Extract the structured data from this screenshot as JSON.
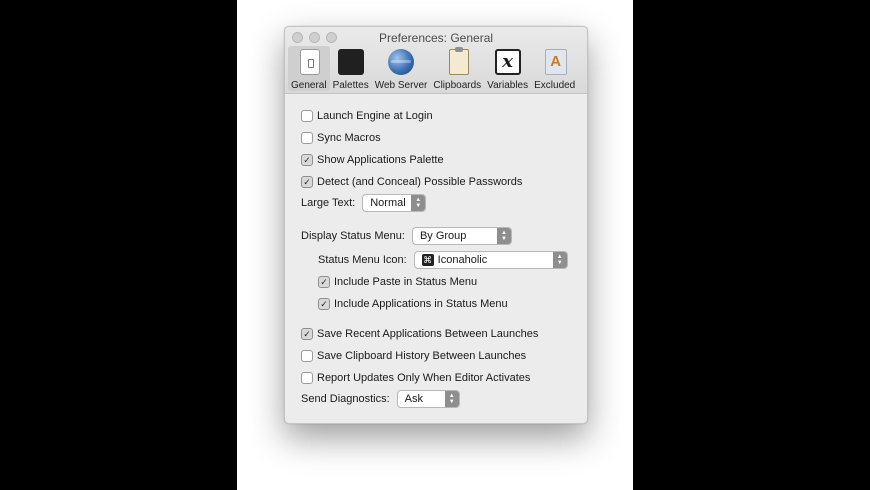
{
  "window": {
    "title": "Preferences: General"
  },
  "tabs": [
    {
      "label": "General",
      "icon": "general-icon",
      "active": true
    },
    {
      "label": "Palettes",
      "icon": "palettes-icon"
    },
    {
      "label": "Web Server",
      "icon": "globe-icon"
    },
    {
      "label": "Clipboards",
      "icon": "clipboard-icon"
    },
    {
      "label": "Variables",
      "icon": "variable-x-icon",
      "glyph": "x"
    },
    {
      "label": "Excluded",
      "icon": "excluded-app-icon",
      "glyph": "A"
    }
  ],
  "options": {
    "launch_engine": {
      "label": "Launch Engine at Login",
      "checked": false
    },
    "sync_macros": {
      "label": "Sync Macros",
      "checked": false
    },
    "show_palette": {
      "label": "Show Applications Palette",
      "checked": true
    },
    "detect_passwords": {
      "label": "Detect (and Conceal) Possible Passwords",
      "checked": true
    },
    "large_text": {
      "label": "Large Text:",
      "value": "Normal"
    },
    "display_status_menu": {
      "label": "Display Status Menu:",
      "value": "By Group"
    },
    "status_menu_icon": {
      "label": "Status Menu Icon:",
      "value": "Iconaholic",
      "glyph": "⌘"
    },
    "include_paste": {
      "label": "Include Paste in Status Menu",
      "checked": true
    },
    "include_apps": {
      "label": "Include Applications in Status Menu",
      "checked": true
    },
    "save_recent_apps": {
      "label": "Save Recent Applications Between Launches",
      "checked": true
    },
    "save_clipboard": {
      "label": "Save Clipboard History Between Launches",
      "checked": false
    },
    "report_updates": {
      "label": "Report Updates Only When Editor Activates",
      "checked": false
    },
    "send_diagnostics": {
      "label": "Send Diagnostics:",
      "value": "Ask"
    }
  },
  "glyphs": {
    "check": "✓",
    "arrow_up": "▲",
    "arrow_down": "▼"
  },
  "colors": {
    "window_bg": "#ececec",
    "active_tab": "#cfcfcf",
    "popup_arrow": "#8e8e8e"
  }
}
